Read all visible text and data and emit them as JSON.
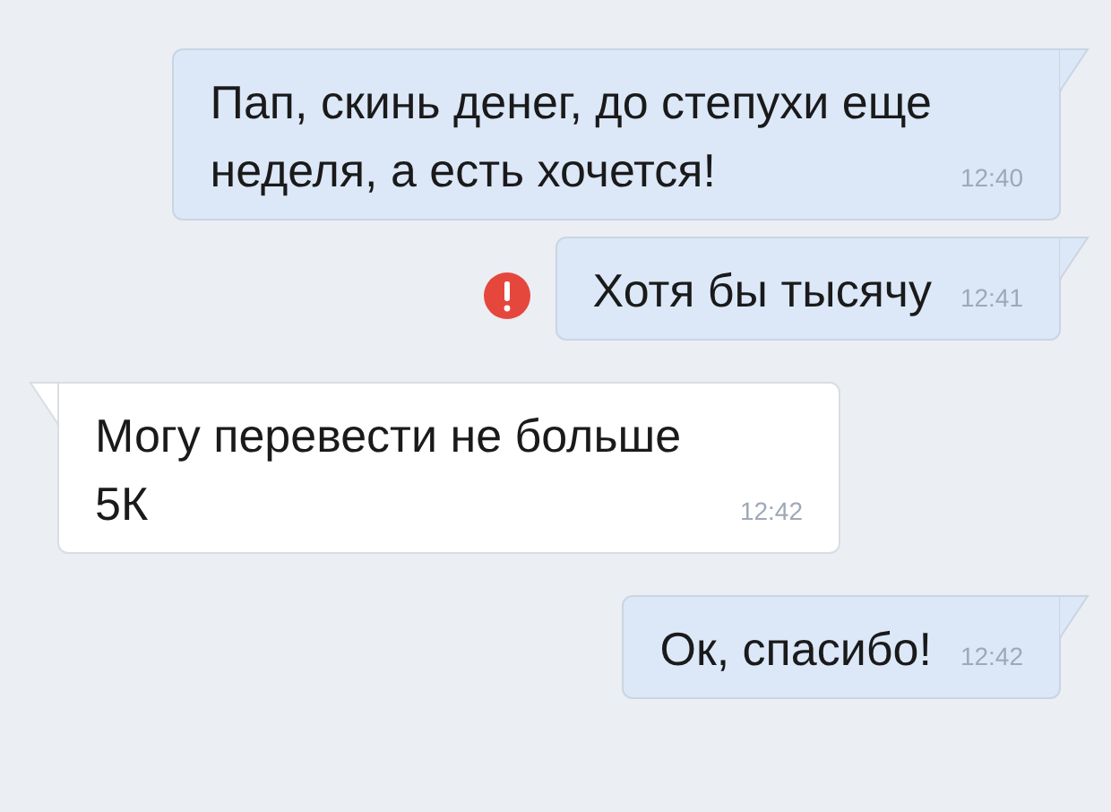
{
  "messages": [
    {
      "kind": "outgoing",
      "text": "Пап, скинь денег, до степухи еще\nнеделя, а есть хочется!",
      "time": "12:40",
      "failed": false
    },
    {
      "kind": "outgoing",
      "text": "Хотя бы тысячу",
      "time": "12:41",
      "failed": true
    },
    {
      "kind": "incoming",
      "text": "Могу перевести не больше\n5К",
      "time": "12:42",
      "failed": false
    },
    {
      "kind": "outgoing",
      "text": "Ок, спасибо!",
      "time": "12:42",
      "failed": false
    }
  ]
}
